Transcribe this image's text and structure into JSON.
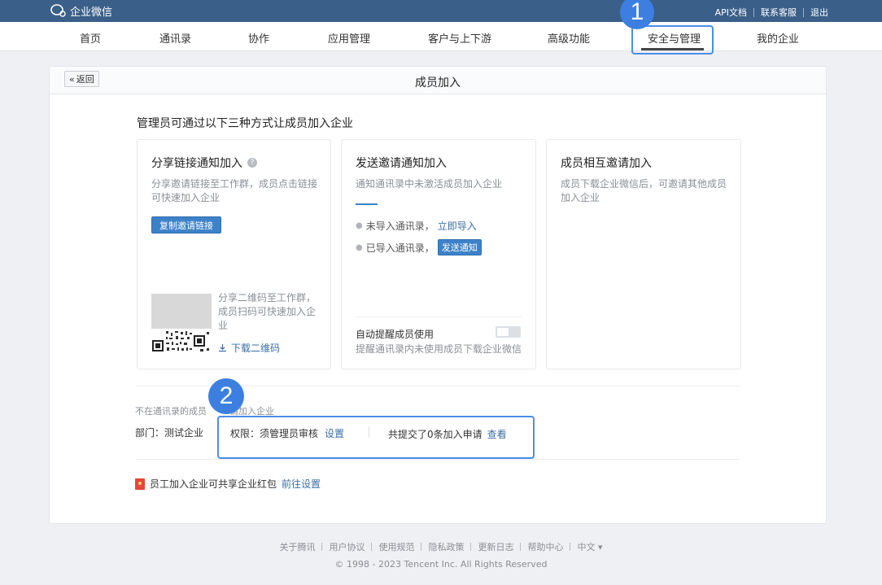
{
  "topbar": {
    "logo_text": "企业微信",
    "links": [
      "API文档",
      "联系客服",
      "退出"
    ]
  },
  "nav": {
    "items": [
      "首页",
      "通讯录",
      "协作",
      "应用管理",
      "客户与上下游",
      "高级功能",
      "安全与管理",
      "我的企业"
    ],
    "active": "安全与管理"
  },
  "callouts": {
    "one": "1",
    "two": "2"
  },
  "panel": {
    "back_label": "返回",
    "title": "成员加入",
    "intro": "管理员可通过以下三种方式让成员加入企业"
  },
  "card_share": {
    "title": "分享链接通知加入",
    "help_glyph": "?",
    "desc": "分享邀请链接至工作群，成员点击链接可快速加入企业",
    "copy_button": "复制邀请链接",
    "qr_text": "分享二维码至工作群，成员扫码可快速加入企业",
    "download_link": "下载二维码"
  },
  "card_invite": {
    "title": "发送邀请通知加入",
    "desc": "通知通讯录中未激活成员加入企业",
    "item1_text": "未导入通讯录，",
    "item1_link": "立即导入",
    "item2_text": "已导入通讯录，",
    "item2_button": "发送通知",
    "auto_title": "自动提醒成员使用",
    "auto_desc": "提醒通讯录内未使用成员下载企业微信",
    "auto_enabled": false
  },
  "card_mutual": {
    "title": "成员相互邀请加入",
    "desc": "成员下载企业微信后，可邀请其他成员加入企业"
  },
  "outside": {
    "text": "不在通讯录的成员",
    "text_tail": "请加入企业",
    "dept": "部门：测试企业",
    "perm_label": "权限：须管理员审核",
    "perm_link": "设置",
    "submits_text": "共提交了0条加入申请",
    "submits_link": "查看"
  },
  "redpack": {
    "text": "员工加入企业可共享企业红包",
    "link": "前往设置"
  },
  "footer": {
    "links": [
      "关于腾讯",
      "用户协议",
      "使用规范",
      "隐私政策",
      "更新日志",
      "帮助中心",
      "中文 ▾"
    ],
    "copyright": "© 1998 - 2023 Tencent Inc. All Rights Reserved"
  }
}
